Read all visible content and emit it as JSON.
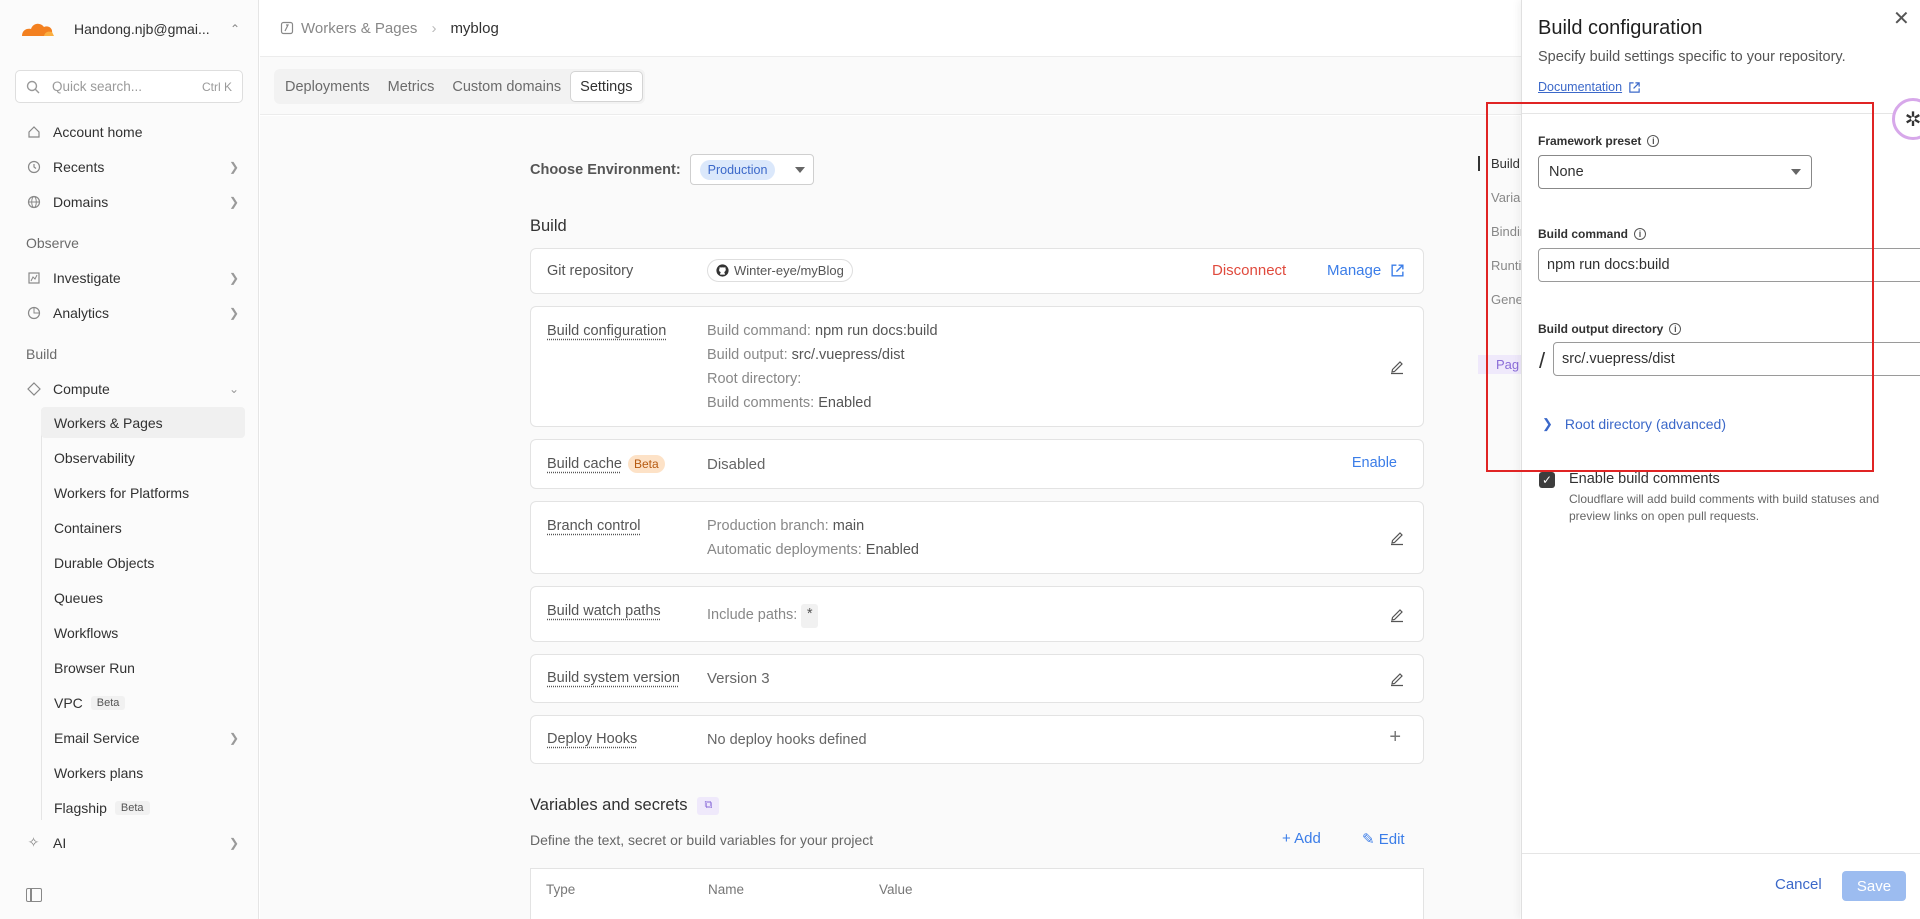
{
  "account": {
    "email": "Handong.njb@gmai...",
    "logo": "cloudflare-logo"
  },
  "search": {
    "placeholder": "Quick search...",
    "shortcut": "Ctrl K"
  },
  "nav": {
    "account_home": "Account home",
    "recents": "Recents",
    "domains": "Domains",
    "observe_section": "Observe",
    "investigate": "Investigate",
    "analytics": "Analytics",
    "build_section": "Build",
    "compute": "Compute",
    "sub": [
      {
        "label": "Workers & Pages"
      },
      {
        "label": "Observability"
      },
      {
        "label": "Workers for Platforms"
      },
      {
        "label": "Containers"
      },
      {
        "label": "Durable Objects"
      },
      {
        "label": "Queues"
      },
      {
        "label": "Workflows"
      },
      {
        "label": "Browser Run"
      },
      {
        "label": "VPC",
        "badge": "Beta"
      },
      {
        "label": "Email Service"
      },
      {
        "label": "Workers plans"
      },
      {
        "label": "Flagship",
        "badge": "Beta"
      }
    ],
    "ai": "AI"
  },
  "breadcrumb": {
    "parent": "Workers & Pages",
    "current": "myblog"
  },
  "tabs": [
    "Deployments",
    "Metrics",
    "Custom domains",
    "Settings"
  ],
  "env": {
    "label": "Choose Environment:",
    "value": "Production"
  },
  "build": {
    "heading": "Build",
    "git": {
      "title": "Git repository",
      "repo": "Winter-eye/myBlog",
      "disconnect": "Disconnect",
      "manage": "Manage"
    },
    "config": {
      "title": "Build configuration",
      "l1k": "Build command:",
      "l1v": "npm run docs:build",
      "l2k": "Build output:",
      "l2v": "src/.vuepress/dist",
      "l3k": "Root directory:",
      "l4k": "Build comments:",
      "l4v": "Enabled"
    },
    "cache": {
      "title": "Build cache",
      "badge": "Beta",
      "value": "Disabled",
      "action": "Enable"
    },
    "branch": {
      "title": "Branch control",
      "l1k": "Production branch:",
      "l1v": "main",
      "l2k": "Automatic deployments:",
      "l2v": "Enabled"
    },
    "watch": {
      "title": "Build watch paths",
      "k": "Include paths:",
      "v": "*"
    },
    "system": {
      "title": "Build system version",
      "value": "Version 3"
    },
    "hooks": {
      "title": "Deploy Hooks",
      "value": "No deploy hooks defined"
    }
  },
  "vars": {
    "heading": "Variables and secrets",
    "desc": "Define the text, secret or build variables for your project",
    "add": "Add",
    "edit": "Edit",
    "cols": [
      "Type",
      "Name",
      "Value"
    ]
  },
  "right_nav": [
    "Build",
    "Variab",
    "Bindin",
    "Runtim",
    "Genera",
    "Pag"
  ],
  "drawer": {
    "title": "Build configuration",
    "subtitle": "Specify build settings specific to your repository.",
    "doc_link": "Documentation",
    "framework_label": "Framework preset",
    "framework_value": "None",
    "cmd_label": "Build command",
    "cmd_value": "npm run docs:build",
    "out_label": "Build output directory",
    "out_prefix": "/",
    "out_value": "src/.vuepress/dist",
    "root_adv": "Root directory (advanced)",
    "comments_label": "Enable build comments",
    "comments_desc": "Cloudflare will add build comments with build statuses and preview links on open pull requests.",
    "cancel": "Cancel",
    "save": "Save"
  },
  "colors": {
    "accent": "#3b7de8",
    "danger": "#e04a3d",
    "highlight_box": "#e02424",
    "brand": "#f38020"
  }
}
